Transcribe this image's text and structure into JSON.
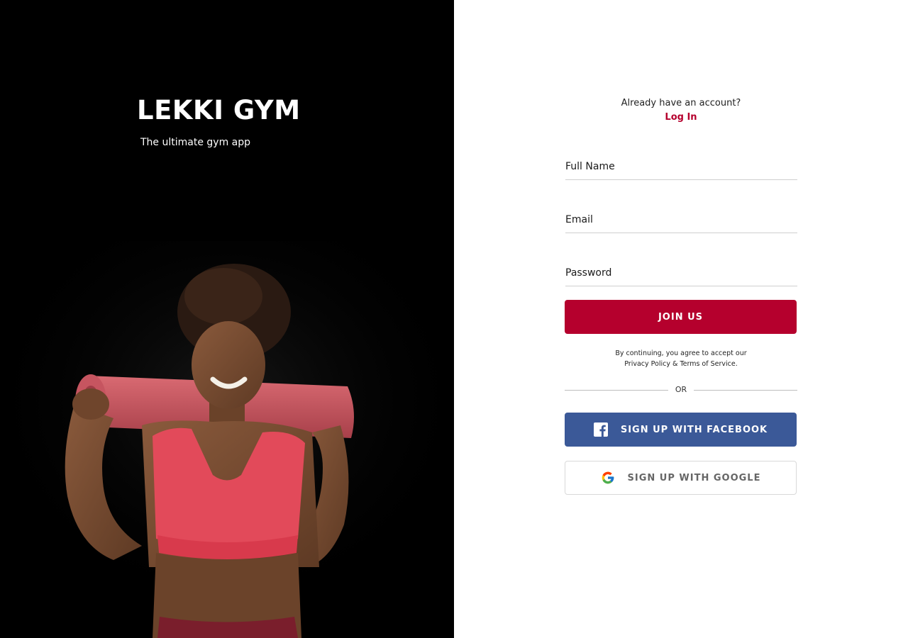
{
  "brand": {
    "title": "LEKKI GYM",
    "tagline": "The ultimate gym app"
  },
  "auth_prompt": {
    "question": "Already have an account?",
    "login_label": "Log In"
  },
  "form": {
    "full_name_placeholder": "Full Name",
    "email_placeholder": "Email",
    "password_placeholder": "Password",
    "submit_label": "JOIN US"
  },
  "consent": {
    "line1": "By continuing, you agree to accept our",
    "line2": "Privacy Policy & Terms of Service."
  },
  "divider_label": "OR",
  "social": {
    "facebook_label": "SIGN UP WITH FACEBOOK",
    "facebook_icon": "facebook-icon",
    "google_label": "SIGN UP WITH GOOGLE",
    "google_icon": "google-icon"
  },
  "colors": {
    "accent": "#b5002d",
    "facebook": "#3b5998",
    "left_panel_bg": "#000000"
  }
}
